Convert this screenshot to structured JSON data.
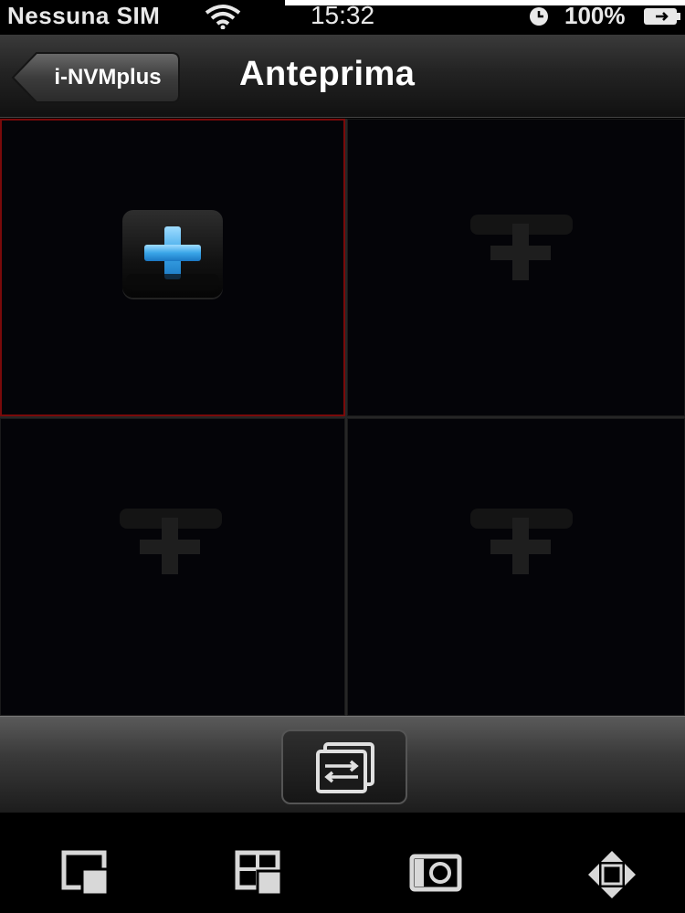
{
  "status_bar": {
    "carrier": "Nessuna SIM",
    "time": "15:32",
    "battery": "100%"
  },
  "nav_bar": {
    "back_label": "i-NVMplus",
    "title": "Anteprima"
  },
  "grid": {
    "selected_cell": 1,
    "accent_color": "#7a0a0a",
    "add_icon_color": "#3aa6e8"
  },
  "toolbar": {
    "icon": "switch-channels-icon"
  },
  "bottom_bar": {
    "icons": [
      "single-view-icon",
      "quad-view-icon",
      "snapshot-icon",
      "ptz-control-icon"
    ]
  }
}
